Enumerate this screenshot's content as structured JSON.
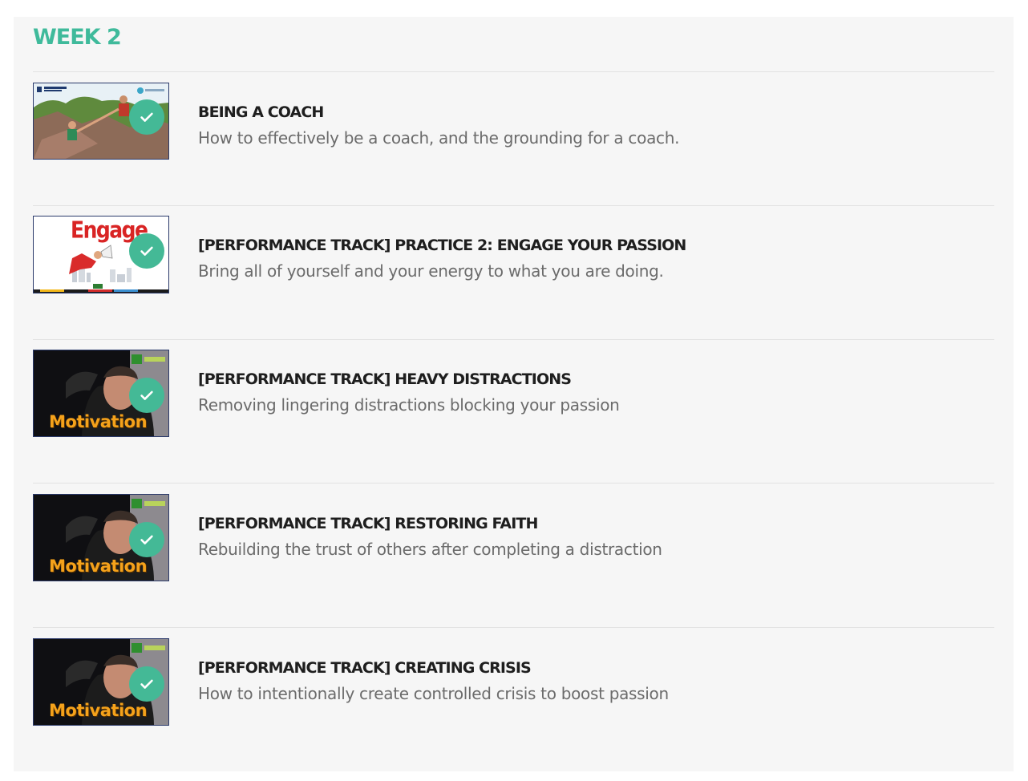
{
  "section": {
    "title": "WEEK 2"
  },
  "colors": {
    "accent": "#3fba9b",
    "check_badge": "#44b996",
    "title_text": "#1e1e1e",
    "desc_text": "#6b6b6b"
  },
  "lessons": [
    {
      "title": "BEING A COACH",
      "description": "How to effectively be a coach, and the grounding for a coach.",
      "thumbnail": "coach-climbers-photo",
      "completed": true
    },
    {
      "title": "[PERFORMANCE TRACK] PRACTICE 2: ENGAGE YOUR PASSION",
      "description": "Bring all of yourself and your energy to what you are doing.",
      "thumbnail": "engage-megaphone-graphic",
      "thumbnail_text": "Engage",
      "completed": true
    },
    {
      "title": "[PERFORMANCE TRACK] HEAVY DISTRACTIONS",
      "description": "Removing lingering distractions blocking your passion",
      "thumbnail": "motivation-climber-photo",
      "thumbnail_text": "Motivation",
      "completed": true
    },
    {
      "title": "[PERFORMANCE TRACK] RESTORING FAITH",
      "description": "Rebuilding the trust of others after completing a distraction",
      "thumbnail": "motivation-climber-photo",
      "thumbnail_text": "Motivation",
      "completed": true
    },
    {
      "title": "[PERFORMANCE TRACK] CREATING CRISIS",
      "description": "How to intentionally create controlled crisis to boost passion",
      "thumbnail": "motivation-climber-photo",
      "thumbnail_text": "Motivation",
      "completed": true
    }
  ]
}
